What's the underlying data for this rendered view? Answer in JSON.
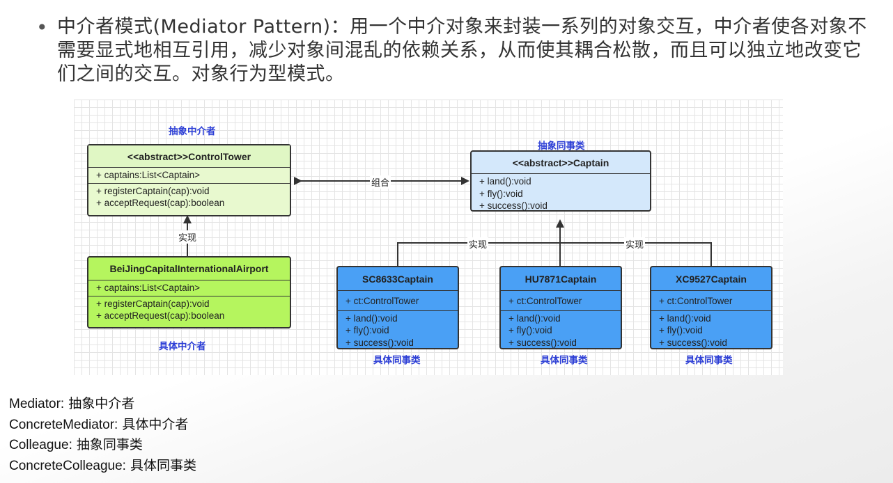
{
  "bullet": {
    "text": "中介者模式(Mediator Pattern)：用一个中介对象来封装一系列的对象交互，中介者使各对象不需要显式地相互引用，减少对象间混乱的依赖关系，从而使其耦合松散，而且可以独立地改变它们之间的交互。对象行为型模式。"
  },
  "diagram": {
    "labels": {
      "abstract_mediator": "抽象中介者",
      "concrete_mediator": "具体中介者",
      "abstract_colleague": "抽象同事类",
      "concrete_colleague_1": "具体同事类",
      "concrete_colleague_2": "具体同事类",
      "concrete_colleague_3": "具体同事类",
      "composition": "组合",
      "realize_left": "实现",
      "realize_right_1": "实现",
      "realize_right_2": "实现"
    },
    "control_tower": {
      "name": "<<abstract>>ControlTower",
      "attr": "+ captains:List<Captain>",
      "method1": "+ registerCaptain(cap):void",
      "method2": "+ acceptRequest(cap):boolean"
    },
    "airport": {
      "name": "BeiJingCapitalInternationalAirport",
      "attr": "+ captains:List<Captain>",
      "method1": "+ registerCaptain(cap):void",
      "method2": "+ acceptRequest(cap):boolean"
    },
    "captain": {
      "name": "<<abstract>>Captain",
      "method1": "+ land():void",
      "method2": "+ fly():void",
      "method3": "+ success():void"
    },
    "sc8633": {
      "name": "SC8633Captain",
      "attr": "+ ct:ControlTower",
      "method1": "+ land():void",
      "method2": "+ fly():void",
      "method3": "+ success():void"
    },
    "hu7871": {
      "name": "HU7871Captain",
      "attr": "+ ct:ControlTower",
      "method1": "+ land():void",
      "method2": "+ fly():void",
      "method3": "+ success():void"
    },
    "xc9527": {
      "name": "XC9527Captain",
      "attr": "+ ct:ControlTower",
      "method1": "+ land():void",
      "method2": "+ fly():void",
      "method3": "+ success():void"
    }
  },
  "legend": [
    {
      "key": "Mediator:",
      "value": "抽象中介者"
    },
    {
      "key": "ConcreteMediator:",
      "value": "具体中介者"
    },
    {
      "key": "Colleague:",
      "value": "抽象同事类"
    },
    {
      "key": "ConcreteColleague:",
      "value": "具体同事类"
    }
  ],
  "colors": {
    "abstract_mediator_fill": "#e8f9cf",
    "concrete_mediator_fill": "#b5f55e",
    "abstract_colleague_fill": "#d4e8fb",
    "concrete_colleague_fill": "#4aa0f5",
    "role_label": "#2d3fd6"
  }
}
